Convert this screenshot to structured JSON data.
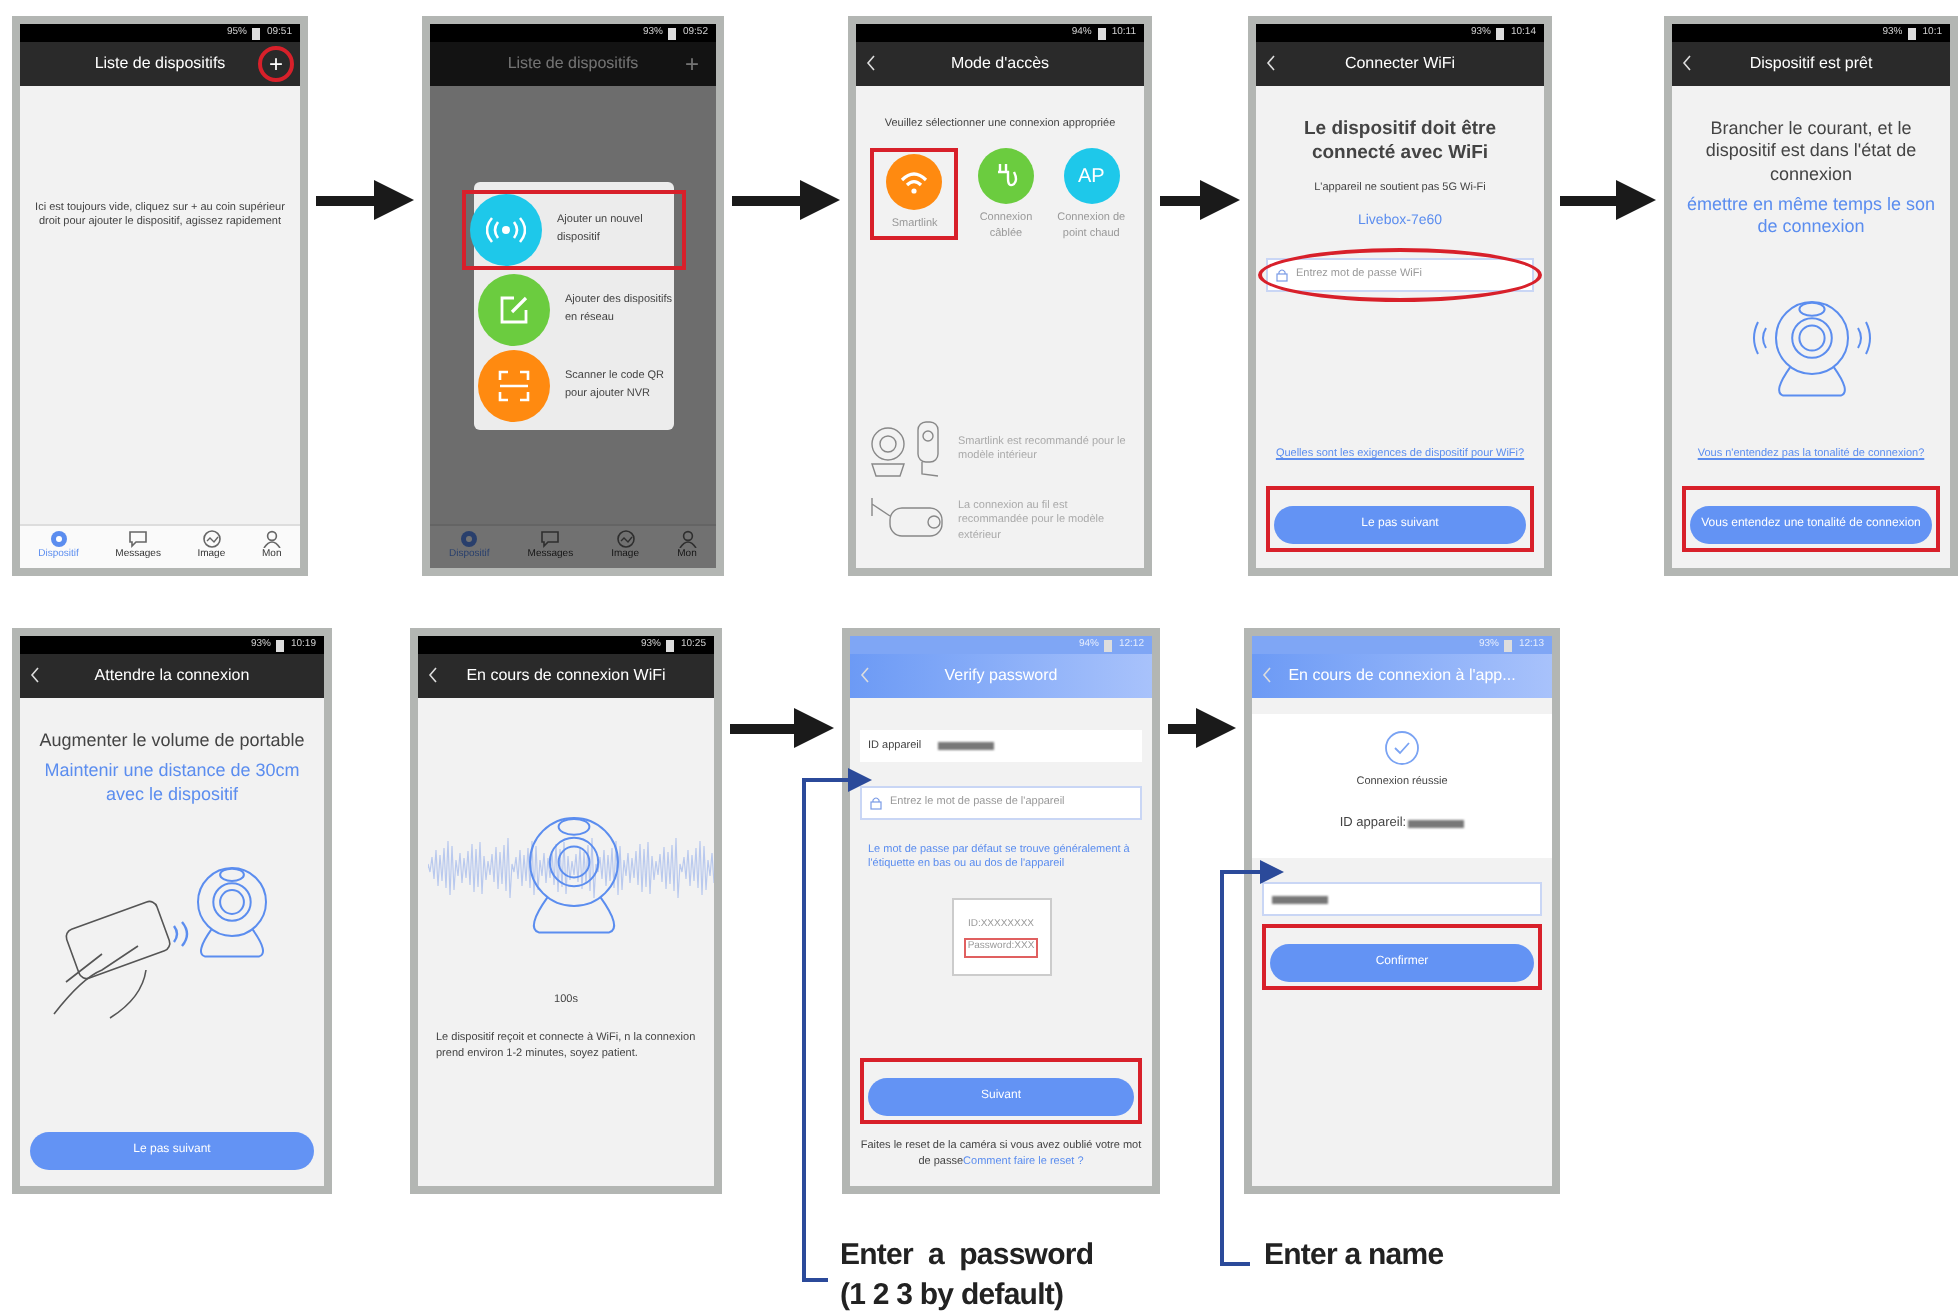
{
  "rows": [
    {
      "screens": [
        {
          "kind": "dark",
          "battery": "95%",
          "time": "09:51",
          "title": "Liste de dispositifs",
          "back": false,
          "action": {
            "text": "+",
            "circled": true
          },
          "arrow_after": true,
          "body": [
            {
              "kind": "intro",
              "text": "Ici est toujours vide, cliquez sur + au coin supérieur droit pour ajouter le dispositif, agissez rapidement"
            }
          ],
          "tabbar": [
            {
              "kind": "device",
              "label": "Dispositif",
              "selected": true
            },
            {
              "kind": "message",
              "label": "Messages",
              "selected": false
            },
            {
              "kind": "image",
              "label": "Image",
              "selected": false
            },
            {
              "kind": "person",
              "label": "Mon",
              "selected": false
            }
          ]
        },
        {
          "kind": "dark",
          "battery": "93%",
          "time": "09:52",
          "title": "Liste de dispositifs",
          "back": false,
          "action": {
            "text": "+",
            "circled": false
          },
          "arrow_after": true,
          "dimmed": true,
          "menu": [
            {
              "kind": "signal",
              "color": "#1ec8ea",
              "label": "Ajouter un nouvel dispositif",
              "highlighted": true
            },
            {
              "kind": "edit",
              "color": "#6bcc3f",
              "label": "Ajouter des dispositifs en réseau",
              "highlighted": false
            },
            {
              "kind": "scan",
              "color": "#ff8a10",
              "label": "Scanner le code QR pour ajouter NVR",
              "highlighted": false
            }
          ],
          "tabbar": [
            {
              "kind": "device",
              "label": "Dispositif",
              "selected": true
            },
            {
              "kind": "message",
              "label": "Messages",
              "selected": false
            },
            {
              "kind": "image",
              "label": "Image",
              "selected": false
            },
            {
              "kind": "person",
              "label": "Mon",
              "selected": false
            }
          ]
        },
        {
          "kind": "dark",
          "battery": "94%",
          "time": "10:11",
          "title": "Mode d'accès",
          "back": true,
          "arrow_after": true,
          "body": [
            {
              "kind": "note",
              "text": "Veuillez sélectionner une connexion appropriée"
            },
            {
              "kind": "choices",
              "items": [
                {
                  "kind": "wifi",
                  "color": "#ff8a10",
                  "label": "Smartlink",
                  "highlighted": true
                },
                {
                  "kind": "cable",
                  "color": "#6bcc3f",
                  "label": "Connexion câblée",
                  "highlighted": false
                },
                {
                  "kind": "text",
                  "icon_text": "AP",
                  "color": "#1ec8ea",
                  "label": "Connexion de point chaud",
                  "highlighted": false
                }
              ]
            }
          ],
          "footer": [
            {
              "kind": "indoor-hint",
              "text": "Smartlink est recommandé pour le modèle intérieur"
            },
            {
              "kind": "outdoor-hint",
              "text": "La connexion au fil est recommandée pour le modèle extérieur"
            }
          ]
        },
        {
          "kind": "dark",
          "battery": "93%",
          "time": "10:14",
          "title": "Connecter WiFi",
          "back": true,
          "arrow_after": true,
          "body": [
            {
              "kind": "heading",
              "text": "Le dispositif doit être connecté avec WiFi"
            },
            {
              "kind": "note",
              "text": "L'appareil ne soutient pas 5G Wi-Fi"
            },
            {
              "kind": "network",
              "text": "Livebox-7e60"
            },
            {
              "kind": "field",
              "placeholder": "Entrez mot de passe WiFi",
              "circled": true
            }
          ],
          "footer": [
            {
              "kind": "link",
              "text": "Quelles sont les exigences de dispositif pour WiFi?"
            },
            {
              "kind": "button",
              "label": "Le pas suivant",
              "highlighted": true
            }
          ]
        },
        {
          "kind": "dark",
          "battery": "93%",
          "time": "10:1",
          "title": "Dispositif est prêt",
          "back": true,
          "body": [
            {
              "kind": "lead",
              "text": "Brancher le courant, et le dispositif est dans l'état de connexion"
            },
            {
              "kind": "emphasis",
              "text": "émettre en même temps le son de connexion"
            },
            {
              "kind": "camera-sound"
            }
          ],
          "footer": [
            {
              "kind": "link",
              "text": "Vous n'entendez pas la tonalité de connexion?"
            },
            {
              "kind": "button",
              "label": "Vous entendez une tonalité de connexion",
              "highlighted": true
            }
          ]
        }
      ]
    },
    {
      "screens": [
        {
          "kind": "dark",
          "battery": "93%",
          "time": "10:19",
          "title": "Attendre la connexion",
          "back": true,
          "arrow_after": false,
          "body": [
            {
              "kind": "lead",
              "text": "Augmenter le volume de portable"
            },
            {
              "kind": "emphasis",
              "text": "Maintenir une distance de 30cm avec le dispositif"
            },
            {
              "kind": "phone-camera"
            }
          ],
          "footer": [
            {
              "kind": "button",
              "label": "Le pas suivant",
              "highlighted": false
            }
          ]
        },
        {
          "kind": "dark",
          "battery": "93%",
          "time": "10:25",
          "title": "En cours de connexion WiFi",
          "back": true,
          "arrow_after": true,
          "body": [
            {
              "kind": "camera-waveform"
            },
            {
              "kind": "note",
              "text": "100s"
            },
            {
              "kind": "caption",
              "text": "Le dispositif reçoit et connecte à WiFi, n la connexion prend environ 1-2 minutes, soyez patient."
            }
          ]
        },
        {
          "kind": "blue",
          "battery": "94%",
          "time": "12:12",
          "title": "Verify password",
          "back": true,
          "arrow_after": true,
          "body": [
            {
              "kind": "form-row",
              "label": "ID appareil"
            },
            {
              "kind": "field",
              "placeholder": "Entrez le mot de passe de l'appareil",
              "circled": false
            },
            {
              "kind": "tip",
              "text": "Le mot de passe par défaut se trouve généralement à l'étiquette en bas ou au dos de l'appareil"
            },
            {
              "kind": "label-card",
              "lines": [
                {
                  "text": "ID:XXXXXXXX",
                  "highlighted": false
                },
                {
                  "text": "Password:XXX",
                  "highlighted": true
                }
              ]
            }
          ],
          "footer": [
            {
              "kind": "button",
              "label": "Suivant",
              "highlighted": true
            },
            {
              "kind": "text-link",
              "text": "Faites le reset de la caméra si vous avez oublié votre mot de passe",
              "link": "Comment faire le reset ?"
            }
          ]
        },
        {
          "kind": "blue",
          "battery": "93%",
          "time": "12:13",
          "title": "En cours de connexion à l'app...",
          "back": true,
          "body": [
            {
              "kind": "success",
              "text": "Connexion réussie",
              "detail": "ID appareil:"
            },
            {
              "kind": "field",
              "circled": false
            },
            {
              "kind": "button",
              "label": "Confirmer",
              "highlighted": true
            }
          ]
        }
      ]
    }
  ],
  "annotations": [
    {
      "lines": [
        "Enter  a  password",
        "(1 2 3 by default)"
      ]
    },
    {
      "lines": [
        "Enter a name"
      ]
    }
  ]
}
